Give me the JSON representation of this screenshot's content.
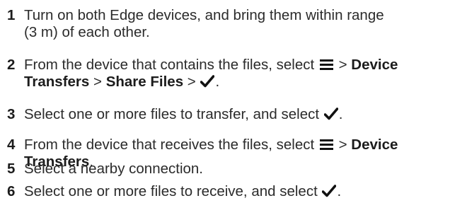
{
  "steps": [
    {
      "number": "1",
      "line1": "Turn on both Edge devices, and bring them within range",
      "line2": "(3 m) of each other."
    },
    {
      "number": "2",
      "pre": "From the device that contains the files, select",
      "gt1": ">",
      "bold1": "Device",
      "bold2": "Transfers",
      "gt2": ">",
      "bold3": "Share Files",
      "gt3": ">",
      "end": "."
    },
    {
      "number": "3",
      "pre": "Select one or more files to transfer, and select",
      "end": "."
    },
    {
      "number": "4",
      "pre": "From the device that receives the files, select",
      "gt1": ">",
      "bold1": "Device",
      "bold2": "Transfers",
      "end": "."
    },
    {
      "number": "5",
      "text": "Select a nearby connection."
    },
    {
      "number": "6",
      "pre": "Select one or more files to receive, and select",
      "end": "."
    }
  ],
  "icons": {
    "menu": "menu-icon",
    "check": "checkmark-icon"
  },
  "colors": {
    "text": "#2b2b2b",
    "icon": "#111111"
  }
}
